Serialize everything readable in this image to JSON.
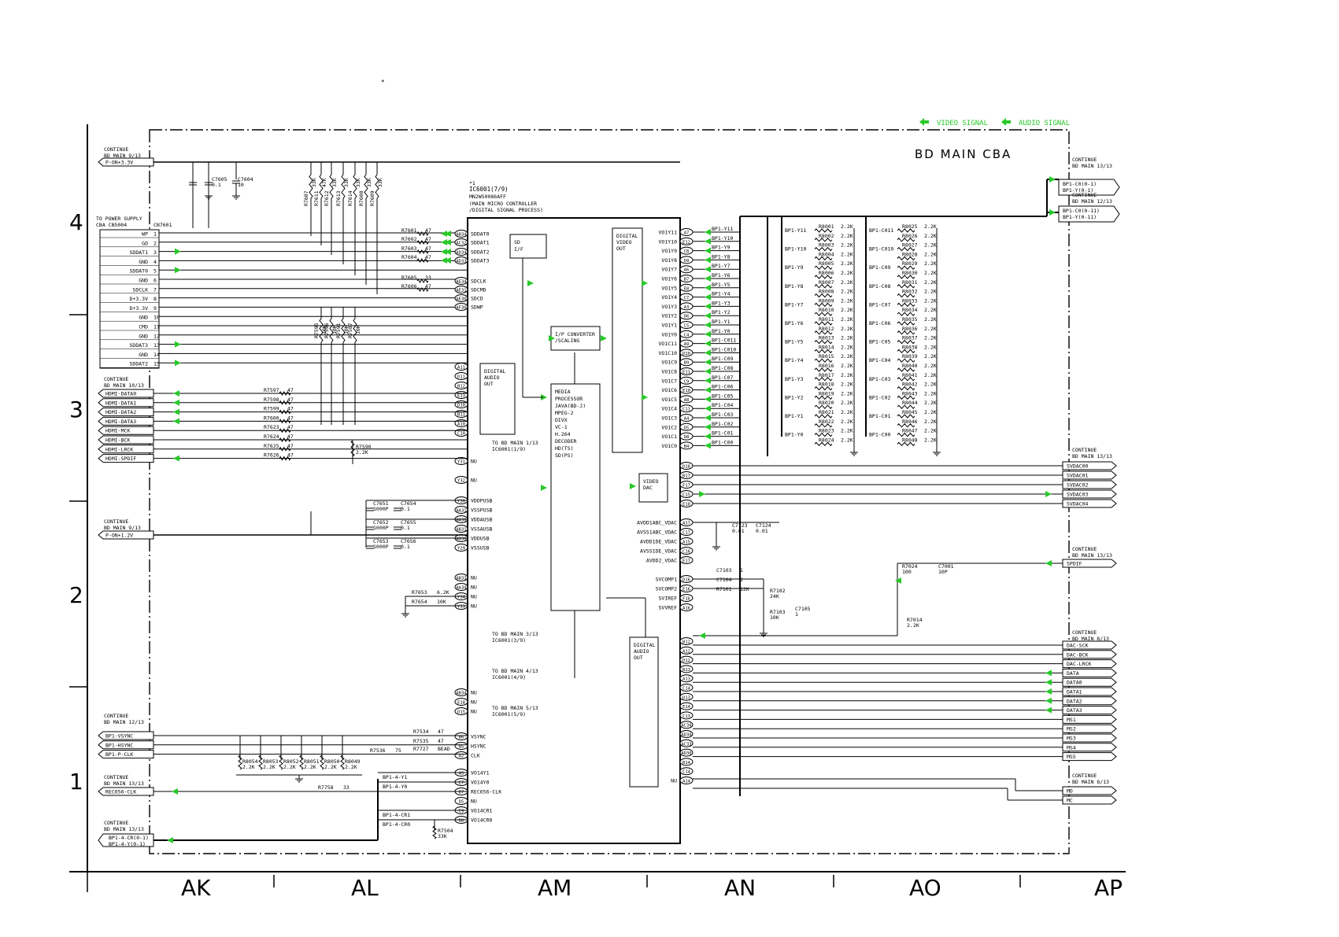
{
  "page": {
    "mark": "*",
    "board_name": "BD MAIN CBA"
  },
  "legend": {
    "video": "VIDEO SIGNAL",
    "audio": "AUDIO SIGNAL",
    "color": "#29c829"
  },
  "grid": {
    "cols": [
      "AK",
      "AL",
      "AM",
      "AN",
      "AO",
      "AP"
    ],
    "rows": [
      "4",
      "3",
      "2",
      "1"
    ]
  },
  "connectors": {
    "pon33": {
      "continue": "CONTINUE",
      "ref": "BD MAIN 9/13",
      "signal": "P-ON+3.3V"
    },
    "power": {
      "line1": "TO POWER SUPPLY",
      "line2": "CBA CN5004",
      "cn": "CN7601",
      "pins": [
        {
          "name": "WP",
          "num": "1"
        },
        {
          "name": "GD",
          "num": "2"
        },
        {
          "name": "SDDAT1",
          "num": "3"
        },
        {
          "name": "GND",
          "num": "4"
        },
        {
          "name": "SDDAT0",
          "num": "5"
        },
        {
          "name": "GND",
          "num": "6"
        },
        {
          "name": "SDCLK",
          "num": "7"
        },
        {
          "name": "D+3.3V",
          "num": "8"
        },
        {
          "name": "D+3.3V",
          "num": "9"
        },
        {
          "name": "GND",
          "num": "10"
        },
        {
          "name": "CMD",
          "num": "11"
        },
        {
          "name": "GND",
          "num": "12"
        },
        {
          "name": "SDDAT3",
          "num": "13"
        },
        {
          "name": "GND",
          "num": "14"
        },
        {
          "name": "SDDAT2",
          "num": "15"
        }
      ]
    },
    "hdmi": {
      "continue": "CONTINUE",
      "ref": "BD MAIN 10/13",
      "signals": [
        "HDMI-DATA0",
        "HDMI-DATA1",
        "HDMI-DATA2",
        "HDMI-DATA3",
        "HDMI-MCK",
        "HDMI-BCK",
        "HDMI-LRCK",
        "HDMI-SPDIF"
      ]
    },
    "pon12": {
      "continue": "CONTINUE",
      "ref": "BD MAIN 9/13",
      "signal": "P-ON+1.2V"
    },
    "sync": {
      "continue": "CONTINUE",
      "ref": "BD MAIN 12/13",
      "signals": [
        "BP1-VSYNC",
        "BP1-HSYNC",
        "BP1-P-CLK"
      ]
    },
    "rec656": {
      "continue": "CONTINUE",
      "ref": "BD MAIN 13/13",
      "signal": "REC656-CLK"
    },
    "bp4": {
      "continue": "CONTINUE",
      "ref": "BD MAIN 13/13",
      "signals": [
        "BP1-4-CR(0-1)",
        "BP1-4-Y(0-1)"
      ]
    },
    "right_top": {
      "continue": "CONTINUE",
      "ref": "BD MAIN 13/13",
      "signals": [
        "BP1-C0(0-1)",
        "BP1-Y(0-1)"
      ]
    },
    "right_top2": {
      "continue": "CONTINUE",
      "ref": "BD MAIN 12/13",
      "signals": [
        "BP1-C0(0-11)",
        "BP1-Y(0-11)"
      ]
    },
    "svdac": {
      "continue": "CONTINUE",
      "ref": "BD MAIN 13/13",
      "signals": [
        "SVDAC00",
        "SVDAC01",
        "SVDAC02",
        "SVDAC03",
        "SVDAC04"
      ]
    },
    "spdif": {
      "continue": "CONTINUE",
      "ref": "BD MAIN 13/13",
      "signal": "SPDIF"
    },
    "dac": {
      "continue": "CONTINUE",
      "ref": "BD MAIN 8/13",
      "signals": [
        "DAC-SCK",
        "DAC-BCK",
        "DAC-LRCK",
        "DATA",
        "DATA0",
        "DATA1",
        "DATA2",
        "DATA3",
        "MS1",
        "MS2",
        "MS3",
        "MS4",
        "MS5"
      ]
    },
    "mdmc": {
      "continue": "CONTINUE",
      "ref": "BD MAIN 8/13",
      "signals": [
        "MD",
        "MC"
      ]
    }
  },
  "ic": {
    "note": "*1",
    "ref": "IC6001(7/9)",
    "part": "MN2WS0086AFF",
    "desc1": "(MAIN MICRO CONTROLLER",
    "desc2": "/DIGITAL SIGNAL PROCESS)",
    "left_pins": [
      {
        "pin": "AB34",
        "name": "SDDAT0"
      },
      {
        "pin": "AC32",
        "name": "SDDAT1"
      },
      {
        "pin": "AD34",
        "name": "SDDAT2"
      },
      {
        "pin": "AD33",
        "name": "SDDAT3"
      },
      {
        "pin": "AE34",
        "name": "SDCLK"
      },
      {
        "pin": "AE31",
        "name": "SDCMD"
      },
      {
        "pin": "AE30",
        "name": "SDCD"
      },
      {
        "pin": "AF30",
        "name": "SDWP"
      },
      {
        "pin": "A11",
        "name": ""
      },
      {
        "pin": "D11",
        "name": ""
      },
      {
        "pin": "B12",
        "name": ""
      },
      {
        "pin": "E13",
        "name": ""
      },
      {
        "pin": "D10",
        "name": ""
      },
      {
        "pin": "B11",
        "name": ""
      },
      {
        "pin": "A10",
        "name": ""
      },
      {
        "pin": "C10",
        "name": ""
      },
      {
        "pin": "Y31",
        "name": "NU"
      },
      {
        "pin": "Y32",
        "name": "NU"
      },
      {
        "pin": "Y30",
        "name": "VDDPUSB"
      },
      {
        "pin": "AA31",
        "name": "VSSPUSB"
      },
      {
        "pin": "AA30",
        "name": "VDDAUSB"
      },
      {
        "pin": "AB31",
        "name": "VSSAUSB"
      },
      {
        "pin": "AB30",
        "name": "VDDUSB"
      },
      {
        "pin": "Y29",
        "name": "VSSUSB"
      },
      {
        "pin": "AB33",
        "name": "NU"
      },
      {
        "pin": "AA34",
        "name": "NU"
      },
      {
        "pin": "Y34",
        "name": "NU"
      },
      {
        "pin": "Y33",
        "name": "NU"
      },
      {
        "pin": "AB34",
        "name": "NU"
      },
      {
        "pin": "E18",
        "name": "NU"
      },
      {
        "pin": "D15",
        "name": "NU"
      },
      {
        "pin": "B6",
        "name": "VSYNC"
      },
      {
        "pin": "B5",
        "name": "HSYNC"
      },
      {
        "pin": "A2",
        "name": "CLK"
      },
      {
        "pin": "A5",
        "name": "VO14Y1"
      },
      {
        "pin": "E7",
        "name": "VO14Y0"
      },
      {
        "pin": "D7",
        "name": "REC656-CLK"
      },
      {
        "pin": "D5",
        "name": "NU"
      },
      {
        "pin": "E9",
        "name": "VO14CR1"
      },
      {
        "pin": "B8",
        "name": "VO14CR0"
      }
    ],
    "right_pins": [
      {
        "pin": "A7",
        "name": "VO1Y11"
      },
      {
        "pin": "E12",
        "name": "VO1Y10"
      },
      {
        "pin": "C8",
        "name": "VO1Y9"
      },
      {
        "pin": "D9",
        "name": "VO1Y8"
      },
      {
        "pin": "A6",
        "name": "VO1Y7"
      },
      {
        "pin": "B7",
        "name": "VO1Y6"
      },
      {
        "pin": "E8",
        "name": "VO1Y5"
      },
      {
        "pin": "C7",
        "name": "VO1Y4"
      },
      {
        "pin": "A3",
        "name": "VO1Y3"
      },
      {
        "pin": "D6",
        "name": "VO1Y2"
      },
      {
        "pin": "C5",
        "name": "VO1Y1"
      },
      {
        "pin": "C4",
        "name": "VO1Y0"
      },
      {
        "pin": "A9",
        "name": "VO1C11"
      },
      {
        "pin": "D10",
        "name": "VO1C10"
      },
      {
        "pin": "B9",
        "name": "VO1C9"
      },
      {
        "pin": "E11",
        "name": "VO1C8"
      },
      {
        "pin": "C9",
        "name": "VO1C7"
      },
      {
        "pin": "E10",
        "name": "VO1C6"
      },
      {
        "pin": "A8",
        "name": "VO1C5"
      },
      {
        "pin": "C11",
        "name": "VO1C4"
      },
      {
        "pin": "A4",
        "name": "VO1C3"
      },
      {
        "pin": "D5",
        "name": "VO1C2"
      },
      {
        "pin": "D8",
        "name": "VO1C1"
      },
      {
        "pin": "B4",
        "name": "VO1C0"
      },
      {
        "pin": "D18",
        "name": ""
      },
      {
        "pin": "B17",
        "name": ""
      },
      {
        "pin": "F17",
        "name": ""
      },
      {
        "pin": "C15",
        "name": ""
      },
      {
        "pin": "E18",
        "name": ""
      },
      {
        "pin": "A17",
        "name": "AVDD1ABC_VDAC"
      },
      {
        "pin": "C17",
        "name": "AVSS1ABC_VDAC"
      },
      {
        "pin": "A15",
        "name": "AVDD1DE_VDAC"
      },
      {
        "pin": "C16",
        "name": "AVSS1DE_VDAC"
      },
      {
        "pin": "E17",
        "name": "AVDD2_VDAC"
      },
      {
        "pin": "D16",
        "name": "SVCOMP1"
      },
      {
        "pin": "E16",
        "name": "SVCOMP2"
      },
      {
        "pin": "F16",
        "name": "SVIREF"
      },
      {
        "pin": "A16",
        "name": "SVVREF"
      },
      {
        "pin": "B12",
        "name": ""
      },
      {
        "pin": "A12",
        "name": ""
      },
      {
        "pin": "D12",
        "name": ""
      },
      {
        "pin": "B13",
        "name": ""
      },
      {
        "pin": "A13",
        "name": ""
      },
      {
        "pin": "C14",
        "name": ""
      },
      {
        "pin": "D13",
        "name": ""
      },
      {
        "pin": "E14",
        "name": ""
      },
      {
        "pin": "C13",
        "name": ""
      },
      {
        "pin": "AC34",
        "name": ""
      },
      {
        "pin": "AD34",
        "name": ""
      },
      {
        "pin": "AC33",
        "name": ""
      },
      {
        "pin": "AD30",
        "name": ""
      },
      {
        "pin": "B14",
        "name": ""
      },
      {
        "pin": "C14",
        "name": ""
      },
      {
        "pin": "A14",
        "name": "NU"
      }
    ],
    "blocks": {
      "sd": [
        "SD",
        "I/F"
      ],
      "audio_in": [
        "DIGITAL",
        "AUDIO",
        "OUT"
      ],
      "ip": [
        "I/P CONVERTER",
        "/SCALING"
      ],
      "video_out": [
        "DIGITAL",
        "VIDEO",
        "OUT"
      ],
      "vdac": [
        "VIDEO",
        "DAC"
      ],
      "media": [
        "MEDIA",
        "PROCESSOR",
        "JAVA(BD-J)",
        "MPEG-2",
        "DIVX",
        "VC-1",
        "H.264",
        "DECODER",
        "HD(TS)",
        "SD(PS)"
      ],
      "audio_out": [
        "DIGITAL",
        "AUDIO",
        "OUT"
      ]
    },
    "to_notes": [
      [
        "TO BD MAIN 1/13",
        "IC6001(1/9)"
      ],
      [
        "TO BD MAIN 3/13",
        "IC6001(3/9)"
      ],
      [
        "TO BD MAIN 4/13",
        "IC6001(4/9)"
      ],
      [
        "TO BD MAIN 5/13",
        "IC6001(5/9)"
      ]
    ]
  },
  "resistors_top": [
    "R7607",
    "R7611",
    "R7612",
    "R7613",
    "R7614",
    "R7608",
    "R7609"
  ],
  "resistors_top_vals": [
    "33K",
    "47K",
    "33K",
    "33K",
    "33K",
    "33K",
    "33K"
  ],
  "sd_series": [
    {
      "ref": "R7601",
      "val": "47"
    },
    {
      "ref": "R7602",
      "val": "47"
    },
    {
      "ref": "R7603",
      "val": "47"
    },
    {
      "ref": "R7604",
      "val": "47"
    },
    {
      "ref": "R7605",
      "val": "33"
    },
    {
      "ref": "R7606",
      "val": "47"
    }
  ],
  "pullups_mid": [
    {
      "ref": "R7595",
      "val": "10K"
    },
    {
      "ref": "R7596",
      "val": "10K"
    },
    {
      "ref": "R7591",
      "val": "10K"
    },
    {
      "ref": "R7587",
      "val": "10K"
    }
  ],
  "hdmi_series": [
    {
      "ref": "R7597",
      "val": "47"
    },
    {
      "ref": "R7598",
      "val": "47"
    },
    {
      "ref": "R7599",
      "val": "47"
    },
    {
      "ref": "R7600",
      "val": "47"
    },
    {
      "ref": "R7623",
      "val": "47"
    },
    {
      "ref": "R7624",
      "val": "47"
    },
    {
      "ref": "R7625",
      "val": "47"
    },
    {
      "ref": "R7626",
      "val": "47"
    }
  ],
  "misc": {
    "c7605": "C7605",
    "c7605v": "0.1",
    "c7604": "C7604",
    "c7604v": "10",
    "r7590": "R7590",
    "r7590v": "2.2K",
    "c7651": "C7651",
    "c7651v": "1000P",
    "c7654": "C7654",
    "c7654v": "0.1",
    "c7652": "C7652",
    "c7652v": "1000P",
    "c7655": "C7655",
    "c7655v": "0.1",
    "c7653": "C7653",
    "c7653v": "1000P",
    "c7656": "C7656",
    "c7656v": "0.1",
    "r7653": "R7653",
    "r7653v": "6.2K",
    "r7654": "R7654",
    "r7654v": "10K",
    "r7534": "R7534",
    "r7534v": "47",
    "r7535": "R7535",
    "r7535v": "47",
    "r7727": "R7727",
    "r7727v": "BEAD",
    "r7536": "R7536",
    "r7536v": "75",
    "r7758": "R7758",
    "r7758v": "33",
    "r7504": "R7504",
    "r7504v": "33K",
    "c7123": "C7123",
    "c7123v": "0.01",
    "c7124": "C7124",
    "c7124v": "0.01",
    "c7103": "C7103",
    "c7103v": "1",
    "c7104": "C7104",
    "c7104v": "1",
    "r7101": "R7101",
    "r7101v": "12K",
    "r7102": "R7102",
    "r7102v": "24K",
    "r7103": "R7103",
    "r7103v": "10K",
    "c7105": "C7105",
    "c7105v": "1",
    "r7024": "R7024",
    "r7024v": "100",
    "c7001": "C7001",
    "c7001v": "10P",
    "r7014": "R7014",
    "r7014v": "2.2K",
    "bp14y1": "BP1-4-Y1",
    "bp14y0": "BP1-4-Y0",
    "bp14cr1": "BP1-4-CR1",
    "bp14cr0": "BP1-4-CR0"
  },
  "sync_res": [
    {
      "ref": "R8054",
      "val": "2.2K"
    },
    {
      "ref": "R8053",
      "val": "2.2K"
    },
    {
      "ref": "R8052",
      "val": "2.2K"
    },
    {
      "ref": "R8051",
      "val": "2.2K"
    },
    {
      "ref": "R8050",
      "val": "2.2K"
    },
    {
      "ref": "R8049",
      "val": "2.2K"
    }
  ],
  "bp_out": [
    "BP1-Y11",
    "BP1-Y10",
    "BP1-Y9",
    "BP1-Y8",
    "BP1-Y7",
    "BP1-Y6",
    "BP1-Y5",
    "BP1-Y4",
    "BP1-Y3",
    "BP1-Y2",
    "BP1-Y1",
    "BP1-Y0",
    "BP1-C011",
    "BP1-C010",
    "BP1-C09",
    "BP1-C08",
    "BP1-C07",
    "BP1-C06",
    "BP1-C05",
    "BP1-C04",
    "BP1-C03",
    "BP1-C02",
    "BP1-C01",
    "BP1-C00"
  ],
  "bank1_labels": [
    "BP1-Y11",
    "BP1-Y10",
    "BP1-Y9",
    "BP1-Y8",
    "BP1-Y7",
    "BP1-Y6",
    "BP1-Y5",
    "BP1-Y4",
    "BP1-Y3",
    "BP1-Y2",
    "BP1-Y1",
    "BP1-Y0"
  ],
  "bank2_labels": [
    "BP1-C011",
    "BP1-C010",
    "BP1-C09",
    "BP1-C08",
    "BP1-C07",
    "BP1-C06",
    "BP1-C05",
    "BP1-C04",
    "BP1-C03",
    "BP1-C02",
    "BP1-C01",
    "BP1-C00"
  ],
  "bank1_res": [
    "R8001",
    "R8002",
    "R8003",
    "R8004",
    "R8005",
    "R8006",
    "R8007",
    "R8008",
    "R8009",
    "R8010",
    "R8011",
    "R8012",
    "R8013",
    "R8014",
    "R8015",
    "R8016",
    "R8017",
    "R8018",
    "R8019",
    "R8020",
    "R8021",
    "R8022",
    "R8023",
    "R8024"
  ],
  "bank2_res": [
    "R8025",
    "R8026",
    "R8027",
    "R8028",
    "R8029",
    "R8030",
    "R8031",
    "R8032",
    "R8033",
    "R8034",
    "R8035",
    "R8036",
    "R8037",
    "R8038",
    "R8039",
    "R8040",
    "R8041",
    "R8042",
    "R8043",
    "R8044",
    "R8045",
    "R8046",
    "R8047",
    "R8048"
  ],
  "bank_val": "2.2K"
}
